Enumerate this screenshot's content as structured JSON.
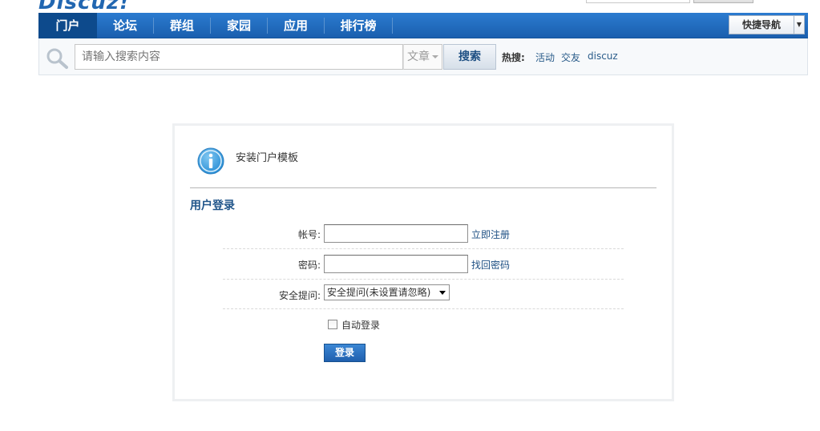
{
  "header": {
    "logo_text": "Discuz!"
  },
  "nav": {
    "items": [
      {
        "label": "门户",
        "active": true
      },
      {
        "label": "论坛",
        "active": false
      },
      {
        "label": "群组",
        "active": false
      },
      {
        "label": "家园",
        "active": false
      },
      {
        "label": "应用",
        "active": false
      },
      {
        "label": "排行榜",
        "active": false
      }
    ],
    "quick_nav_label": "快捷导航"
  },
  "search": {
    "placeholder": "请输入搜索内容",
    "type_label": "文章",
    "button_label": "搜索",
    "hot_label": "热搜:",
    "hot_links": [
      "活动",
      "交友",
      "discuz"
    ]
  },
  "notice": {
    "message": "安装门户模板"
  },
  "login": {
    "title": "用户登录",
    "account_label": "帐号:",
    "register_link": "立即注册",
    "password_label": "密码:",
    "forgot_link": "找回密码",
    "question_label": "安全提问:",
    "question_selected": "安全提问(未设置请忽略)",
    "remember_label": "自动登录",
    "submit_label": "登录"
  },
  "colors": {
    "nav_blue": "#1a5fae",
    "link_blue": "#1d4f83",
    "title_blue": "#20558a"
  }
}
